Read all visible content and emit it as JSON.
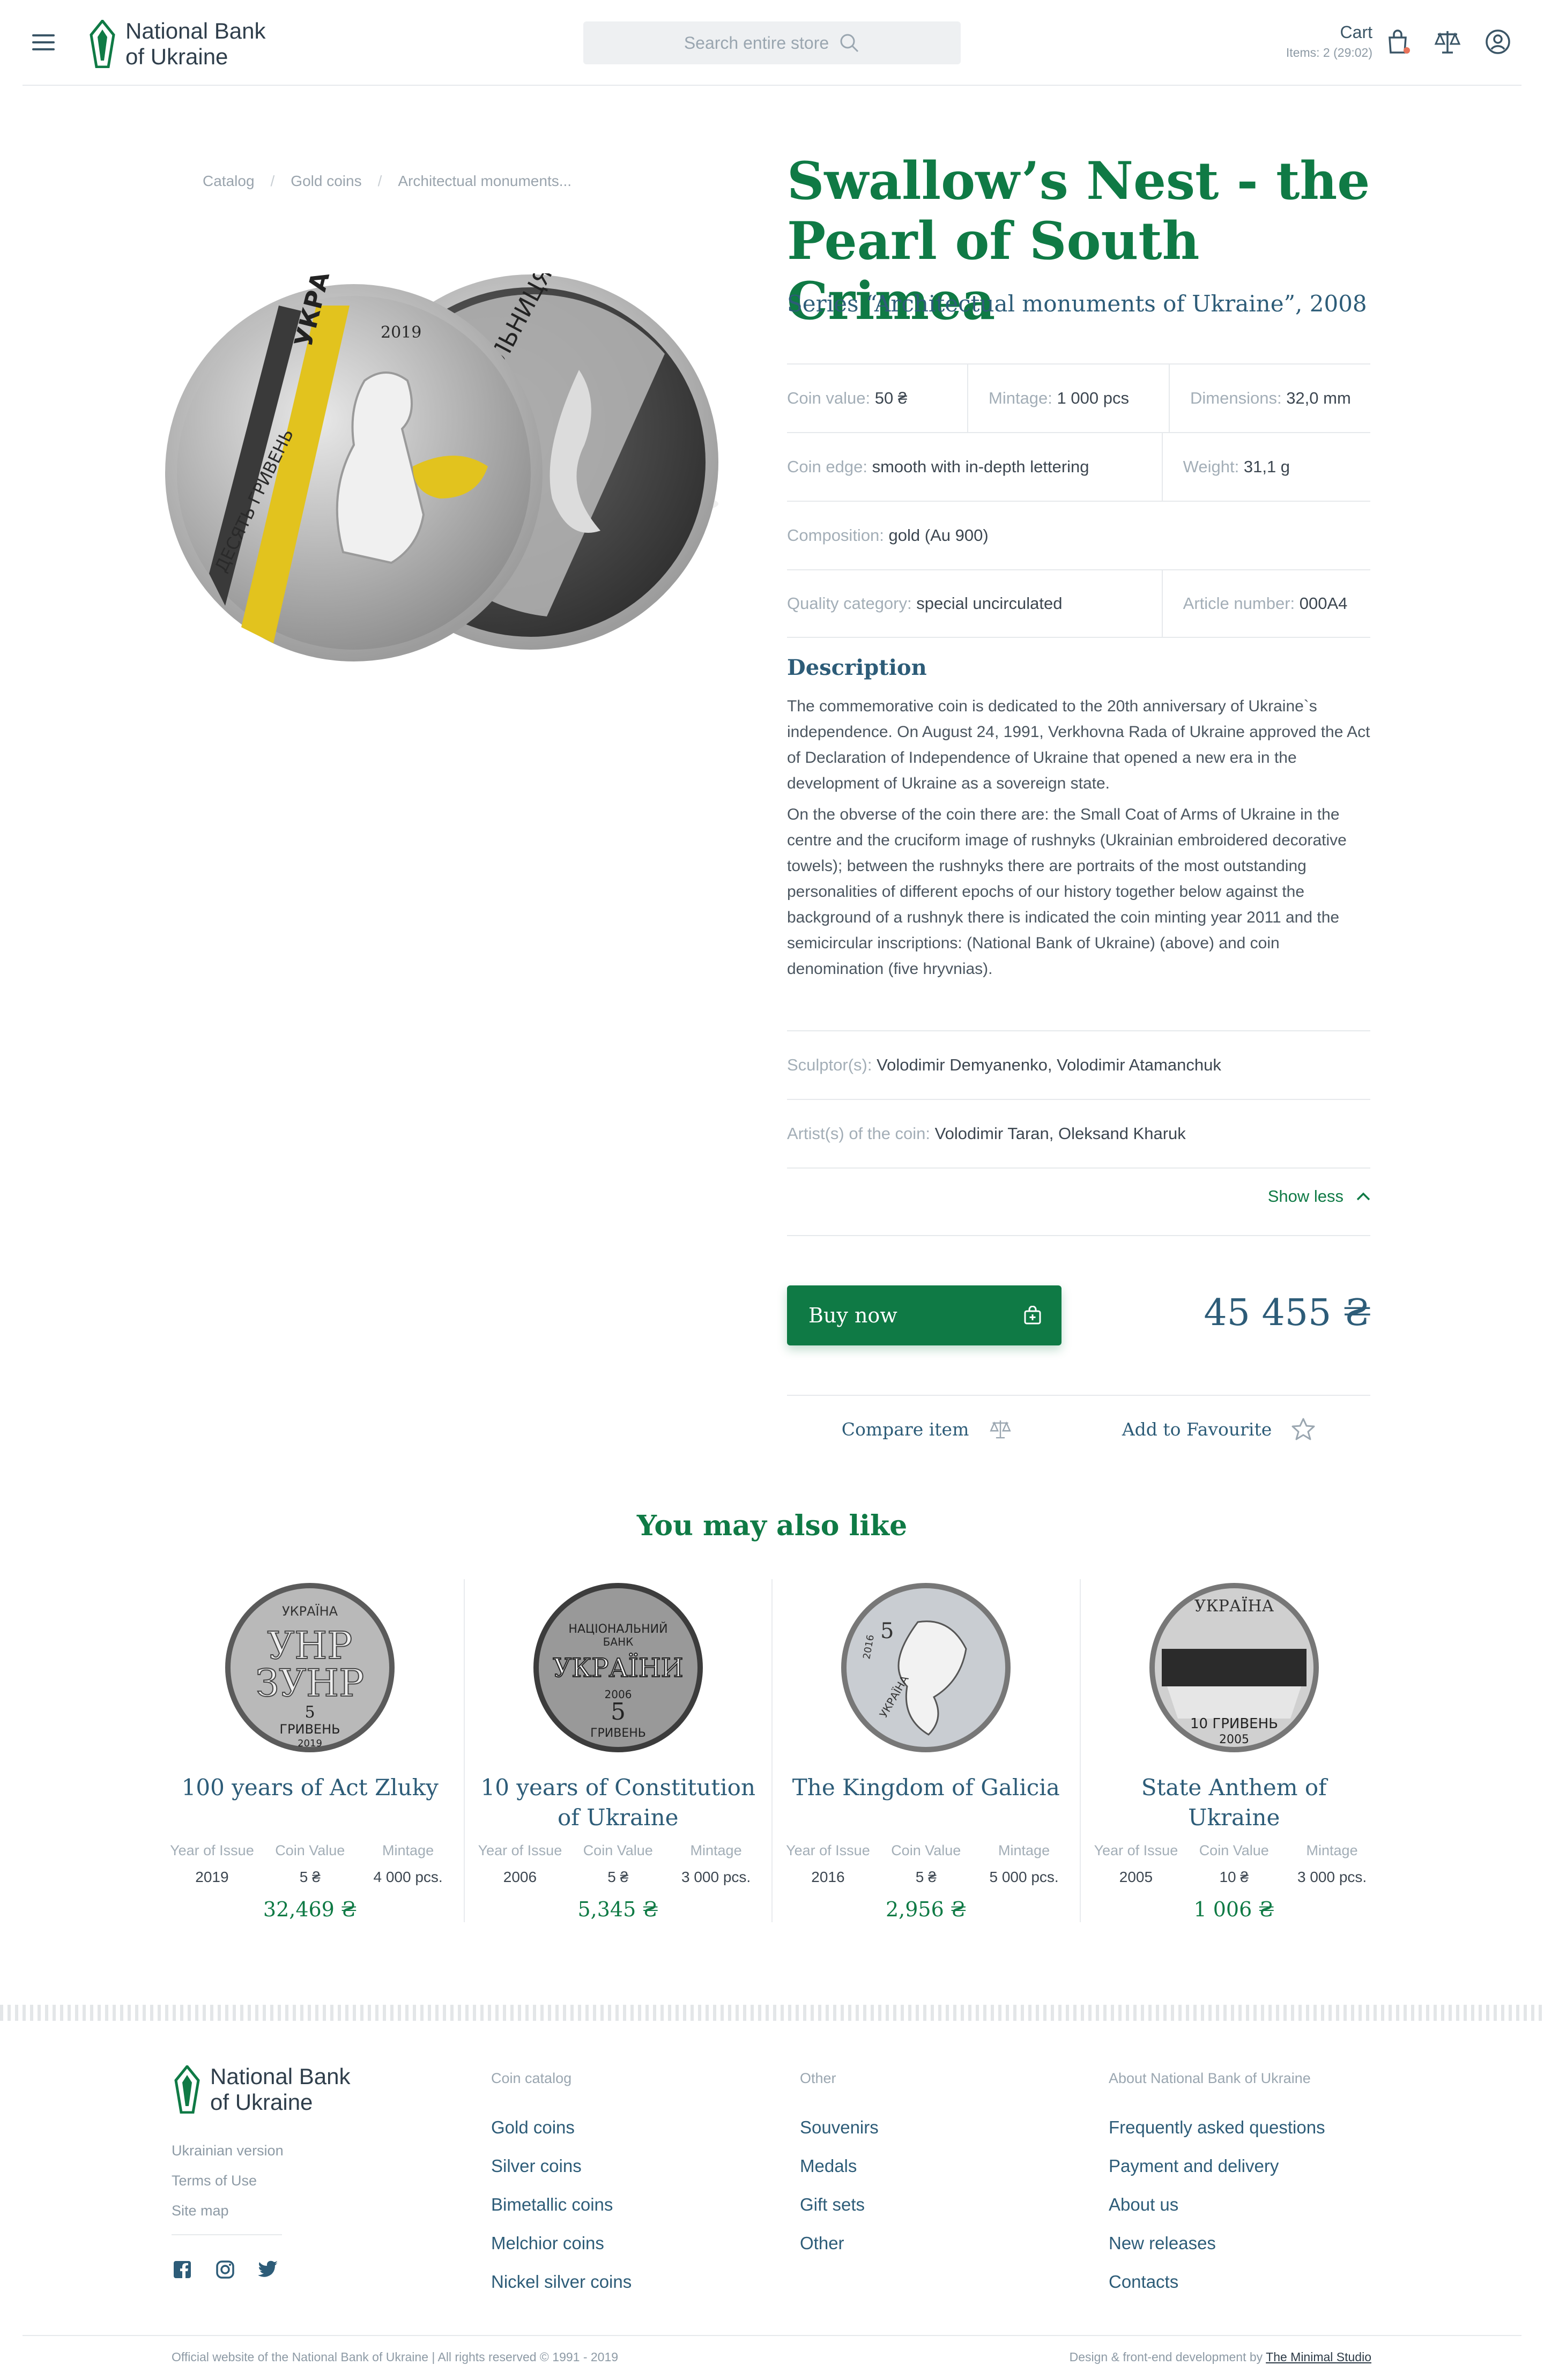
{
  "header": {
    "brand": [
      "National Bank",
      "of Ukraine"
    ],
    "search_placeholder": "Search entire store",
    "cart_label": "Cart",
    "cart_items": "Items: 2 (29:02)"
  },
  "breadcrumb": [
    "Catalog",
    "Gold coins",
    "Architectual monuments..."
  ],
  "product": {
    "title": "Swallow’s Nest - the Pearl of South Crimea",
    "series": "Series “Architectual monuments of Ukraine”, 2008",
    "specs": [
      [
        {
          "label": "Coin value:",
          "value": "50 ₴"
        },
        {
          "label": "Mintage:",
          "value": "1 000 pcs"
        },
        {
          "label": "Dimensions:",
          "value": "32,0 mm"
        }
      ],
      [
        {
          "label": "Coin edge:",
          "value": "smooth with in-depth lettering"
        },
        {
          "label": "Weight:",
          "value": "31,1 g"
        }
      ],
      [
        {
          "label": "Composition:",
          "value": "gold (Au 900)"
        }
      ],
      [
        {
          "label": "Quality category:",
          "value": "special uncirculated"
        },
        {
          "label": "Article number:",
          "value": "000A4"
        }
      ]
    ],
    "description_title": "Description",
    "description": [
      "The commemorative coin is dedicated to the 20th anniversary of Ukraine`s independence. On August 24, 1991, Verkhovna Rada of Ukraine approved the Act of Declaration of Independence of Ukraine that opened a new era in the development of Ukraine as a sovereign state.",
      "On the obverse of the coin there are: the Small Coat of Arms of Ukraine in the centre and the cruciform image of rushnyks (Ukrainian embroidered decorative towels); between the rushnyks there are portraits of the most outstanding personalities of different epochs of our history together below against the background of a rushnyk there is indicated the coin minting year 2011 and the semicircular inscriptions: (National Bank of Ukraine) (above) and coin denomination (five hryvnias)."
    ],
    "credits": [
      {
        "label": "Sculptor(s):",
        "value": "Volodimir Demyanenko, Volodimir Atamanchuk"
      },
      {
        "label": "Artist(s) of the coin:",
        "value": "Volodimir Taran, Oleksand Kharuk"
      }
    ],
    "show_less": "Show less",
    "buy_label": "Buy now",
    "price": "45 455 ₴",
    "compare_label": "Compare item",
    "favourite_label": "Add to Favourite",
    "coin_text": {
      "year": "2019",
      "country": "УКРАЇНА",
      "denom": "ДЕСЯТЬ ГРИВЕНЬ",
      "reverse": "ЛЬНИЦЯ"
    }
  },
  "recommendations": {
    "title": "You may also like",
    "labels": {
      "year": "Year of Issue",
      "value": "Coin Value",
      "mintage": "Mintage"
    },
    "items": [
      {
        "name": "100 years of Act Zluky",
        "year": "2019",
        "value": "5 ₴",
        "mintage": "4 000 pcs.",
        "price": "32,469 ₴",
        "coin": [
          "УКРАЇНА",
          "УНР",
          "ЗУНР",
          "5",
          "ГРИВЕНЬ",
          "2019"
        ]
      },
      {
        "name": "10 years of Constitution of Ukraine",
        "year": "2006",
        "value": "5 ₴",
        "mintage": "3 000 pcs.",
        "price": "5,345 ₴",
        "coin": [
          "НАЦІОНАЛЬНИЙ",
          "БАНК",
          "УКРАЇНИ",
          "2006",
          "5",
          "ГРИВЕНЬ"
        ]
      },
      {
        "name": "The Kingdom of Galicia",
        "year": "2016",
        "value": "5 ₴",
        "mintage": "5 000 pcs.",
        "price": "2,956 ₴",
        "coin": [
          "5",
          "2016",
          "УКРАЇНА"
        ]
      },
      {
        "name": "State Anthem of Ukraine",
        "year": "2005",
        "value": "10 ₴",
        "mintage": "3 000 pcs.",
        "price": "1 006 ₴",
        "coin": [
          "УКРАЇНА",
          "10 ГРИВЕНЬ",
          "2005"
        ]
      }
    ]
  },
  "footer": {
    "brand": [
      "National Bank",
      "of Ukraine"
    ],
    "links": [
      "Ukrainian version",
      "Terms of Use",
      "Site map"
    ],
    "columns": [
      {
        "title": "Coin catalog",
        "items": [
          "Gold coins",
          "Silver coins",
          "Bimetallic coins",
          "Melchior coins",
          "Nickel silver coins"
        ]
      },
      {
        "title": "Other",
        "items": [
          "Souvenirs",
          "Medals",
          "Gift sets",
          "Other"
        ]
      },
      {
        "title": "About National Bank of Ukraine",
        "items": [
          "Frequently asked questions",
          "Payment and delivery",
          "About us",
          "New releases",
          "Contacts"
        ]
      }
    ],
    "copyright": "Official website of the National Bank of Ukraine | All rights reserved © 1991 - 2019",
    "dev_prefix": "Design & front-end development by",
    "dev_name": "The Minimal Studio"
  },
  "colors": {
    "brand_green": "#0f7a45",
    "heading_blue": "#2d5c78",
    "cart_dot": "#e8735a"
  },
  "icons": [
    "menu-icon",
    "search-icon",
    "cart-icon",
    "compare-scales-icon",
    "user-icon",
    "bag-icon",
    "chevron-up-icon",
    "star-icon",
    "facebook-icon",
    "instagram-icon",
    "twitter-icon"
  ]
}
